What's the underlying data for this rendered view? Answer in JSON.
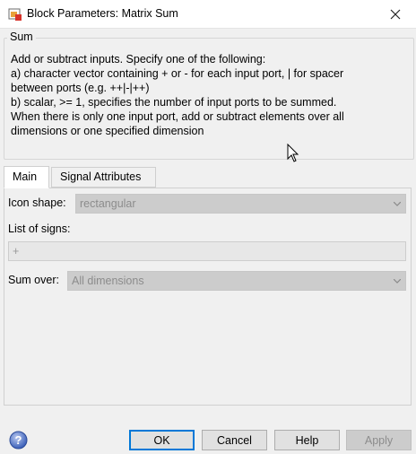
{
  "window": {
    "title": "Block Parameters: Matrix Sum",
    "icon": "simulink-block-icon",
    "close_icon": "close-icon"
  },
  "group": {
    "title": "Sum",
    "description": "Add or subtract inputs.  Specify one of the following:\na) character vector containing + or - for each input port, | for spacer\nbetween ports (e.g. ++|-|++)\nb) scalar, >= 1, specifies the number of input ports to be summed.\nWhen there is only one input port, add or subtract elements over all\ndimensions or one specified dimension"
  },
  "tabs": [
    {
      "label": "Main",
      "active": true
    },
    {
      "label": "Signal Attributes",
      "active": false
    }
  ],
  "main": {
    "icon_shape_label": "Icon shape:",
    "icon_shape_value": "rectangular",
    "list_of_signs_label": "List of signs:",
    "list_of_signs_value": "+",
    "sum_over_label": "Sum over:",
    "sum_over_value": "All dimensions"
  },
  "buttons": {
    "ok": "OK",
    "cancel": "Cancel",
    "help": "Help",
    "apply": "Apply"
  },
  "colors": {
    "default_button_border": "#0078d7",
    "disabled_field": "#cccccc"
  }
}
